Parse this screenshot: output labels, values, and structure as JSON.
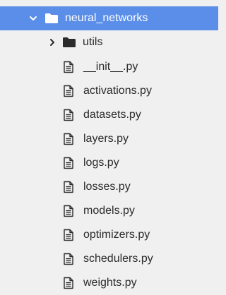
{
  "tree": {
    "root": {
      "label": "neural_networks",
      "expanded": true,
      "icon": "folder-icon",
      "color_selected_bg": "#5a8ee8"
    },
    "subfolder": {
      "label": "utils",
      "expanded": false,
      "icon": "folder-icon"
    },
    "files": [
      {
        "label": "__init__.py",
        "icon": "file-icon"
      },
      {
        "label": "activations.py",
        "icon": "file-icon"
      },
      {
        "label": "datasets.py",
        "icon": "file-icon"
      },
      {
        "label": "layers.py",
        "icon": "file-icon"
      },
      {
        "label": "logs.py",
        "icon": "file-icon"
      },
      {
        "label": "losses.py",
        "icon": "file-icon"
      },
      {
        "label": "models.py",
        "icon": "file-icon"
      },
      {
        "label": "optimizers.py",
        "icon": "file-icon"
      },
      {
        "label": "schedulers.py",
        "icon": "file-icon"
      },
      {
        "label": "weights.py",
        "icon": "file-icon"
      }
    ]
  }
}
